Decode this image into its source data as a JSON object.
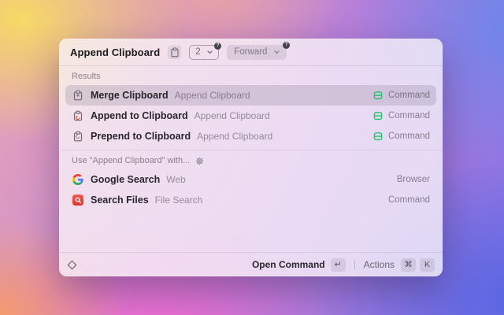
{
  "header": {
    "title": "Append Clipboard",
    "param_icon": "clipboard-icon",
    "count_dropdown": {
      "value": "2",
      "badge": "?"
    },
    "mode_dropdown": {
      "value": "Forward",
      "badge": "?"
    }
  },
  "sections": [
    {
      "label": "Results",
      "rows": [
        {
          "icon": "merge-clipboard-icon",
          "title": "Merge Clipboard",
          "subtitle": "Append Clipboard",
          "accessory_icon": "command-tile-icon",
          "accessory": "Command",
          "selected": true
        },
        {
          "icon": "append-clipboard-icon",
          "title": "Append to Clipboard",
          "subtitle": "Append Clipboard",
          "accessory_icon": "command-tile-icon",
          "accessory": "Command",
          "selected": false
        },
        {
          "icon": "prepend-clipboard-icon",
          "title": "Prepend to Clipboard",
          "subtitle": "Append Clipboard",
          "accessory_icon": "command-tile-icon",
          "accessory": "Command",
          "selected": false
        }
      ]
    },
    {
      "label": "Use \"Append Clipboard\" with...",
      "label_icon": "gear-icon",
      "rows": [
        {
          "icon": "google-icon",
          "title": "Google Search",
          "subtitle": "Web",
          "accessory": "Browser"
        },
        {
          "icon": "file-search-icon",
          "title": "Search Files",
          "subtitle": "File Search",
          "accessory": "Command"
        }
      ]
    }
  ],
  "footer": {
    "app_icon": "raycast-logo-icon",
    "primary_label": "Open Command",
    "primary_key": "↵",
    "actions_label": "Actions",
    "actions_keys": [
      "⌘",
      "K"
    ]
  },
  "colors": {
    "accent_green": "#1fc46a",
    "selection": "rgba(130,118,136,0.24)",
    "file_search_red": "#e0392c"
  }
}
